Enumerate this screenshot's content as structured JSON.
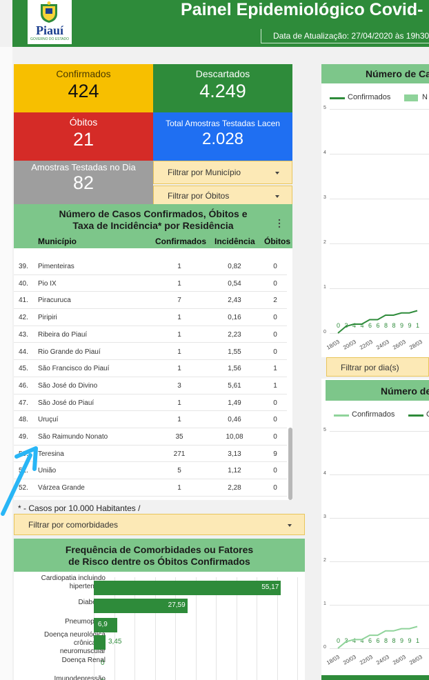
{
  "header": {
    "title": "Painel Epidemiológico Covid-",
    "update": "Data de Atualização: 27/04/2020 às 19h30",
    "logo_text": "Piauí",
    "logo_sub": "GOVERNO DO ESTADO"
  },
  "colors": {
    "green": "#2e8b3a",
    "light_green": "#7dc68a",
    "yellow": "#f7bf00",
    "red": "#d52b27",
    "blue": "#1f6ff2",
    "gray": "#9e9e9e",
    "filter_bg": "#fce9b6"
  },
  "kpis": {
    "confirmados": {
      "label": "Confirmados",
      "value": "424"
    },
    "descartados": {
      "label": "Descartados",
      "value": "4.249"
    },
    "obitos": {
      "label": "Óbitos",
      "value": "21"
    },
    "amostras_lacen": {
      "label": "Total Amostras Testadas Lacen",
      "value": "2.028"
    },
    "amostras_dia": {
      "label": "Amostras Testadas no Dia",
      "value": "82"
    }
  },
  "filters": {
    "municipio": "Filtrar por Município",
    "obitos": "Filtrar por Óbitos",
    "comorbidades": "Filtrar por comorbidades",
    "dia": "Filtrar por dia(s)"
  },
  "table": {
    "title_line1": "Número de Casos Confirmados, Óbitos e",
    "title_line2": "Taxa de Incidência* por Residência",
    "columns": {
      "municipio": "Município",
      "confirmados": "Confirmados",
      "incidencia": "Incidência",
      "obitos": "Óbitos"
    },
    "rows": [
      {
        "idx": "39.",
        "municipio": "Pimenteiras",
        "confirmados": "1",
        "incidencia": "0,82",
        "obitos": "0"
      },
      {
        "idx": "40.",
        "municipio": "Pio IX",
        "confirmados": "1",
        "incidencia": "0,54",
        "obitos": "0"
      },
      {
        "idx": "41.",
        "municipio": "Piracuruca",
        "confirmados": "7",
        "incidencia": "2,43",
        "obitos": "2"
      },
      {
        "idx": "42.",
        "municipio": "Piripiri",
        "confirmados": "1",
        "incidencia": "0,16",
        "obitos": "0"
      },
      {
        "idx": "43.",
        "municipio": "Ribeira do Piauí",
        "confirmados": "1",
        "incidencia": "2,23",
        "obitos": "0"
      },
      {
        "idx": "44.",
        "municipio": "Rio Grande do Piauí",
        "confirmados": "1",
        "incidencia": "1,55",
        "obitos": "0"
      },
      {
        "idx": "45.",
        "municipio": "São Francisco do Piauí",
        "confirmados": "1",
        "incidencia": "1,56",
        "obitos": "1"
      },
      {
        "idx": "46.",
        "municipio": "São José do Divino",
        "confirmados": "3",
        "incidencia": "5,61",
        "obitos": "1"
      },
      {
        "idx": "47.",
        "municipio": "São José do Piauí",
        "confirmados": "1",
        "incidencia": "1,49",
        "obitos": "0"
      },
      {
        "idx": "48.",
        "municipio": "Uruçuí",
        "confirmados": "1",
        "incidencia": "0,46",
        "obitos": "0"
      },
      {
        "idx": "49.",
        "municipio": "São Raimundo Nonato",
        "confirmados": "35",
        "incidencia": "10,08",
        "obitos": "0"
      },
      {
        "idx": "50.",
        "municipio": "Teresina",
        "confirmados": "271",
        "incidencia": "3,13",
        "obitos": "9"
      },
      {
        "idx": "51.",
        "municipio": "União",
        "confirmados": "5",
        "incidencia": "1,12",
        "obitos": "0"
      },
      {
        "idx": "52.",
        "municipio": "Várzea Grande",
        "confirmados": "1",
        "incidencia": "2,28",
        "obitos": "0"
      }
    ],
    "footnote": "* - Casos por 10.000 Habitantes /"
  },
  "comorbidades": {
    "title_line1": "Frequência de Comorbidades ou Fatores",
    "title_line2": "de Risco dentre os Óbitos Confirmados",
    "items": [
      {
        "label_lines": [
          "Cardiopatia incluindo",
          "hipertensão"
        ],
        "value": 55.17,
        "value_label": "55,17"
      },
      {
        "label_lines": [
          "Diabetes"
        ],
        "value": 27.59,
        "value_label": "27,59"
      },
      {
        "label_lines": [
          "Pneumopatia"
        ],
        "value": 6.9,
        "value_label": "6,9"
      },
      {
        "label_lines": [
          "Doença neurológica",
          "crônica ou",
          "neuromuscular"
        ],
        "value": 3.45,
        "value_label": "3,45"
      },
      {
        "label_lines": [
          "Doença Renal"
        ],
        "value": 0,
        "value_label": "0"
      },
      {
        "label_lines": [
          "Imunodepressão"
        ],
        "value": 0,
        "value_label": "0"
      }
    ]
  },
  "charts": {
    "top": {
      "title": "Número de Ca",
      "legend_confirmados": "Confirmados",
      "legend_second": "N"
    },
    "bottom": {
      "title": "Número de",
      "legend_confirmados": "Confirmados",
      "legend_second": "Ó"
    }
  },
  "chart_data": [
    {
      "type": "bar",
      "orientation": "horizontal",
      "title": "Frequência de Comorbidades ou Fatores de Risco dentre os Óbitos Confirmados",
      "categories": [
        "Cardiopatia incluindo hipertensão",
        "Diabetes",
        "Pneumopatia",
        "Doença neurológica crônica ou neuromuscular",
        "Doença Renal",
        "Imunodepressão"
      ],
      "values": [
        55.17,
        27.59,
        6.9,
        3.45,
        0,
        0
      ],
      "xlim": [
        0,
        60
      ]
    },
    {
      "type": "line",
      "title": "Número de Ca",
      "x": [
        "18/03",
        "20/03",
        "22/03",
        "24/03",
        "26/03",
        "28/03"
      ],
      "yticks": [
        "0",
        "1",
        "2",
        "3",
        "4",
        "5"
      ],
      "point_labels": [
        "0",
        "3",
        "4",
        "4",
        "6",
        "6",
        "8",
        "8",
        "9",
        "9",
        "1"
      ],
      "point_values": [
        0,
        3,
        4,
        4,
        6,
        6,
        8,
        8,
        9,
        9,
        10
      ],
      "series": [
        {
          "name": "Confirmados"
        }
      ]
    },
    {
      "type": "line",
      "title": "Número de",
      "x": [
        "18/03",
        "20/03",
        "22/03",
        "24/03",
        "26/03",
        "28/03"
      ],
      "yticks": [
        "0",
        "1",
        "2",
        "3",
        "4",
        "5"
      ],
      "point_labels": [
        "0",
        "3",
        "4",
        "4",
        "6",
        "6",
        "8",
        "8",
        "9",
        "9",
        "1"
      ],
      "point_values": [
        0,
        3,
        4,
        4,
        6,
        6,
        8,
        8,
        9,
        9,
        10
      ],
      "series": [
        {
          "name": "Confirmados"
        }
      ]
    }
  ]
}
